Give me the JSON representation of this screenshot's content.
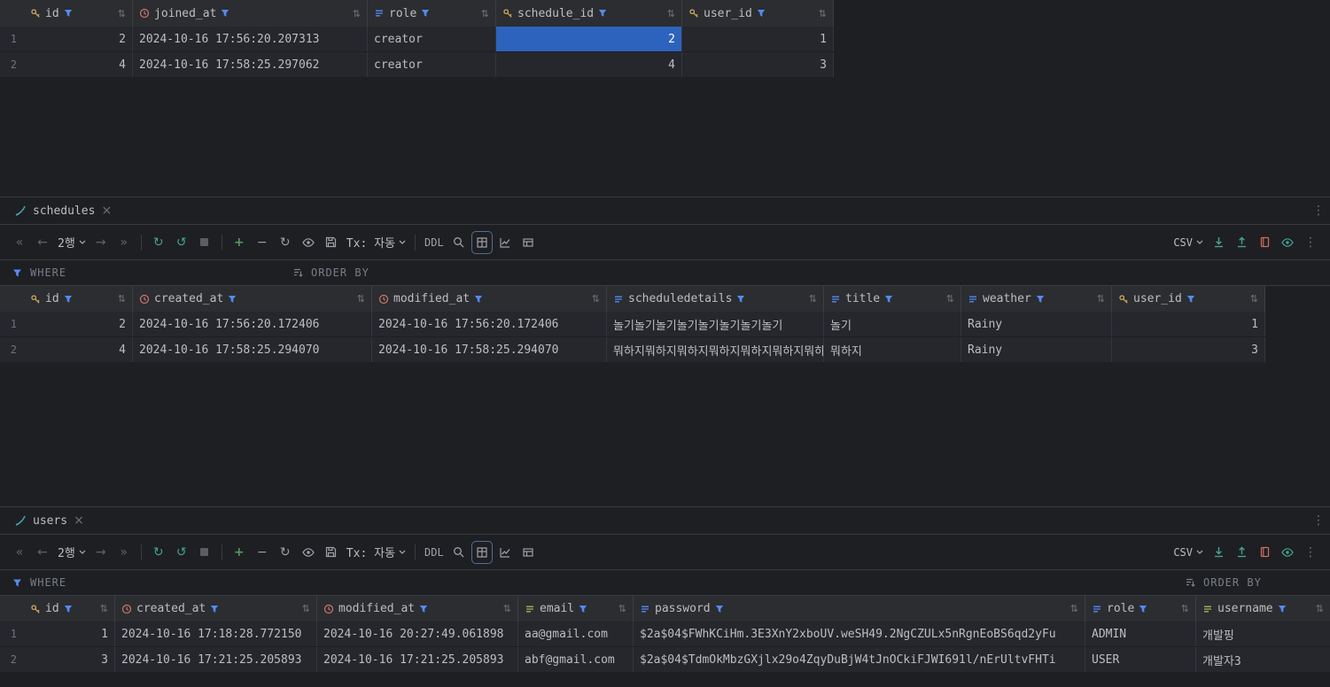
{
  "colors": {
    "background": "#1e1f22",
    "header_bg": "#2b2d30",
    "row_bg": "#25272c",
    "border": "#393b40",
    "text": "#bcbec4",
    "muted_text": "#6f737a",
    "filter_blue": "#548af7",
    "selection_blue": "#2d63bd",
    "key_gold": "#d6a85a",
    "datetime_red": "#d0766d",
    "unique_olive": "#a8b35f",
    "teal": "#42a394",
    "green": "#57965c"
  },
  "icons": {
    "first-page": "«",
    "prev-page": "←",
    "next-page": "→",
    "last-page": "»",
    "reload": "↻",
    "history": "↺",
    "kebab": "⋮",
    "close": "×",
    "sort": "⇅",
    "add": "+",
    "remove": "−",
    "filter": "funnel",
    "where": "funnel",
    "order-by": "sort-lines"
  },
  "top_grid": {
    "row_numbers": [
      "1",
      "2"
    ],
    "columns": [
      {
        "label": "id",
        "type": "key"
      },
      {
        "label": "joined_at",
        "type": "datetime"
      },
      {
        "label": "role",
        "type": "text"
      },
      {
        "label": "schedule_id",
        "type": "key"
      },
      {
        "label": "user_id",
        "type": "key"
      }
    ],
    "rows": [
      [
        "2",
        "2024-10-16 17:56:20.207313",
        "creator",
        "2",
        "1"
      ],
      [
        "4",
        "2024-10-16 17:58:25.297062",
        "creator",
        "4",
        "3"
      ]
    ],
    "selected_cell": {
      "row": 0,
      "col": 3
    }
  },
  "schedules_panel": {
    "tab_label": "schedules",
    "toolbar": {
      "rows_page_label": "2행",
      "tx_label": "Tx: 자동",
      "ddl_label": "DDL",
      "csv_label": "CSV"
    },
    "filter_bar": {
      "where_label": "WHERE",
      "order_by_label": "ORDER BY"
    },
    "grid": {
      "row_numbers": [
        "1",
        "2"
      ],
      "columns": [
        {
          "label": "id",
          "type": "key"
        },
        {
          "label": "created_at",
          "type": "datetime"
        },
        {
          "label": "modified_at",
          "type": "datetime"
        },
        {
          "label": "scheduledetails",
          "type": "text"
        },
        {
          "label": "title",
          "type": "text"
        },
        {
          "label": "weather",
          "type": "text"
        },
        {
          "label": "user_id",
          "type": "key"
        }
      ],
      "rows": [
        [
          "2",
          "2024-10-16 17:56:20.172406",
          "2024-10-16 17:56:20.172406",
          "놀기놀기놀기놀기놀기놀기놀기놀기",
          "놀기",
          "Rainy",
          "1"
        ],
        [
          "4",
          "2024-10-16 17:58:25.294070",
          "2024-10-16 17:58:25.294070",
          "뭐하지뭐하지뭐하지뭐하지뭐하지뭐하지뭐하지",
          "뭐하지",
          "Rainy",
          "3"
        ]
      ]
    }
  },
  "users_panel": {
    "tab_label": "users",
    "toolbar": {
      "rows_page_label": "2행",
      "tx_label": "Tx: 자동",
      "ddl_label": "DDL",
      "csv_label": "CSV"
    },
    "filter_bar": {
      "where_label": "WHERE",
      "order_by_label": "ORDER BY"
    },
    "grid": {
      "row_numbers": [
        "1",
        "2"
      ],
      "columns": [
        {
          "label": "id",
          "type": "key"
        },
        {
          "label": "created_at",
          "type": "datetime"
        },
        {
          "label": "modified_at",
          "type": "datetime"
        },
        {
          "label": "email",
          "type": "unique"
        },
        {
          "label": "password",
          "type": "text"
        },
        {
          "label": "role",
          "type": "text"
        },
        {
          "label": "username",
          "type": "unique"
        }
      ],
      "rows": [
        [
          "1",
          "2024-10-16 17:18:28.772150",
          "2024-10-16 20:27:49.061898",
          "aa@gmail.com",
          "$2a$04$FWhKCiHm.3E3XnY2xboUV.weSH49.2NgCZULx5nRgnEoBS6qd2yFu",
          "ADMIN",
          "개발핑"
        ],
        [
          "3",
          "2024-10-16 17:21:25.205893",
          "2024-10-16 17:21:25.205893",
          "abf@gmail.com",
          "$2a$04$TdmOkMbzGXjlx29o4ZqyDuBjW4tJnOCkiFJWI691l/nErUltvFHTi",
          "USER",
          "개발자3"
        ]
      ]
    }
  }
}
